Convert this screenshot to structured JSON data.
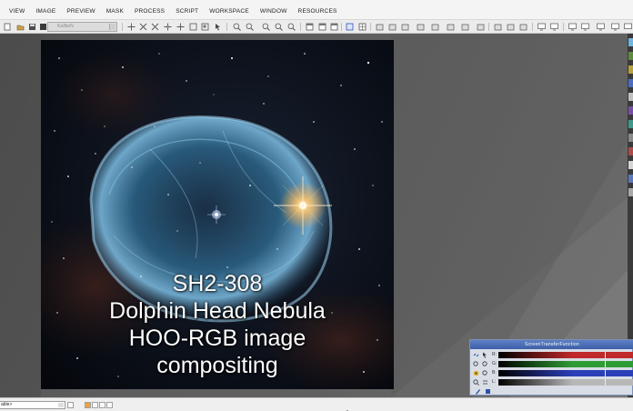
{
  "menubar": {
    "items": [
      {
        "label": "VIEW"
      },
      {
        "label": "IMAGE"
      },
      {
        "label": "PREVIEW"
      },
      {
        "label": "MASK"
      },
      {
        "label": "PROCESS"
      },
      {
        "label": "SCRIPT"
      },
      {
        "label": "WORKSPACE"
      },
      {
        "label": "WINDOW"
      },
      {
        "label": "RESOURCES"
      }
    ]
  },
  "toolbar": {
    "view_select_value": "Ka3bcN"
  },
  "image_window": {
    "caption_lines": [
      "SH2-308",
      "Dolphin Head Nebula",
      "HOO-RGB image",
      "compositing"
    ]
  },
  "stf_panel": {
    "title": "ScreenTransferFunction",
    "channels": [
      {
        "label": "R:",
        "color": "#c0282a"
      },
      {
        "label": "G:",
        "color": "#2e9c34"
      },
      {
        "label": "B:",
        "color": "#2a3fb8"
      },
      {
        "label": "L:",
        "color": "#b8b8b8"
      }
    ]
  },
  "statusbar": {
    "select_value": "able>"
  },
  "colors": {
    "accent": "#3d5fa8",
    "workspace": "#5c5c5c"
  }
}
